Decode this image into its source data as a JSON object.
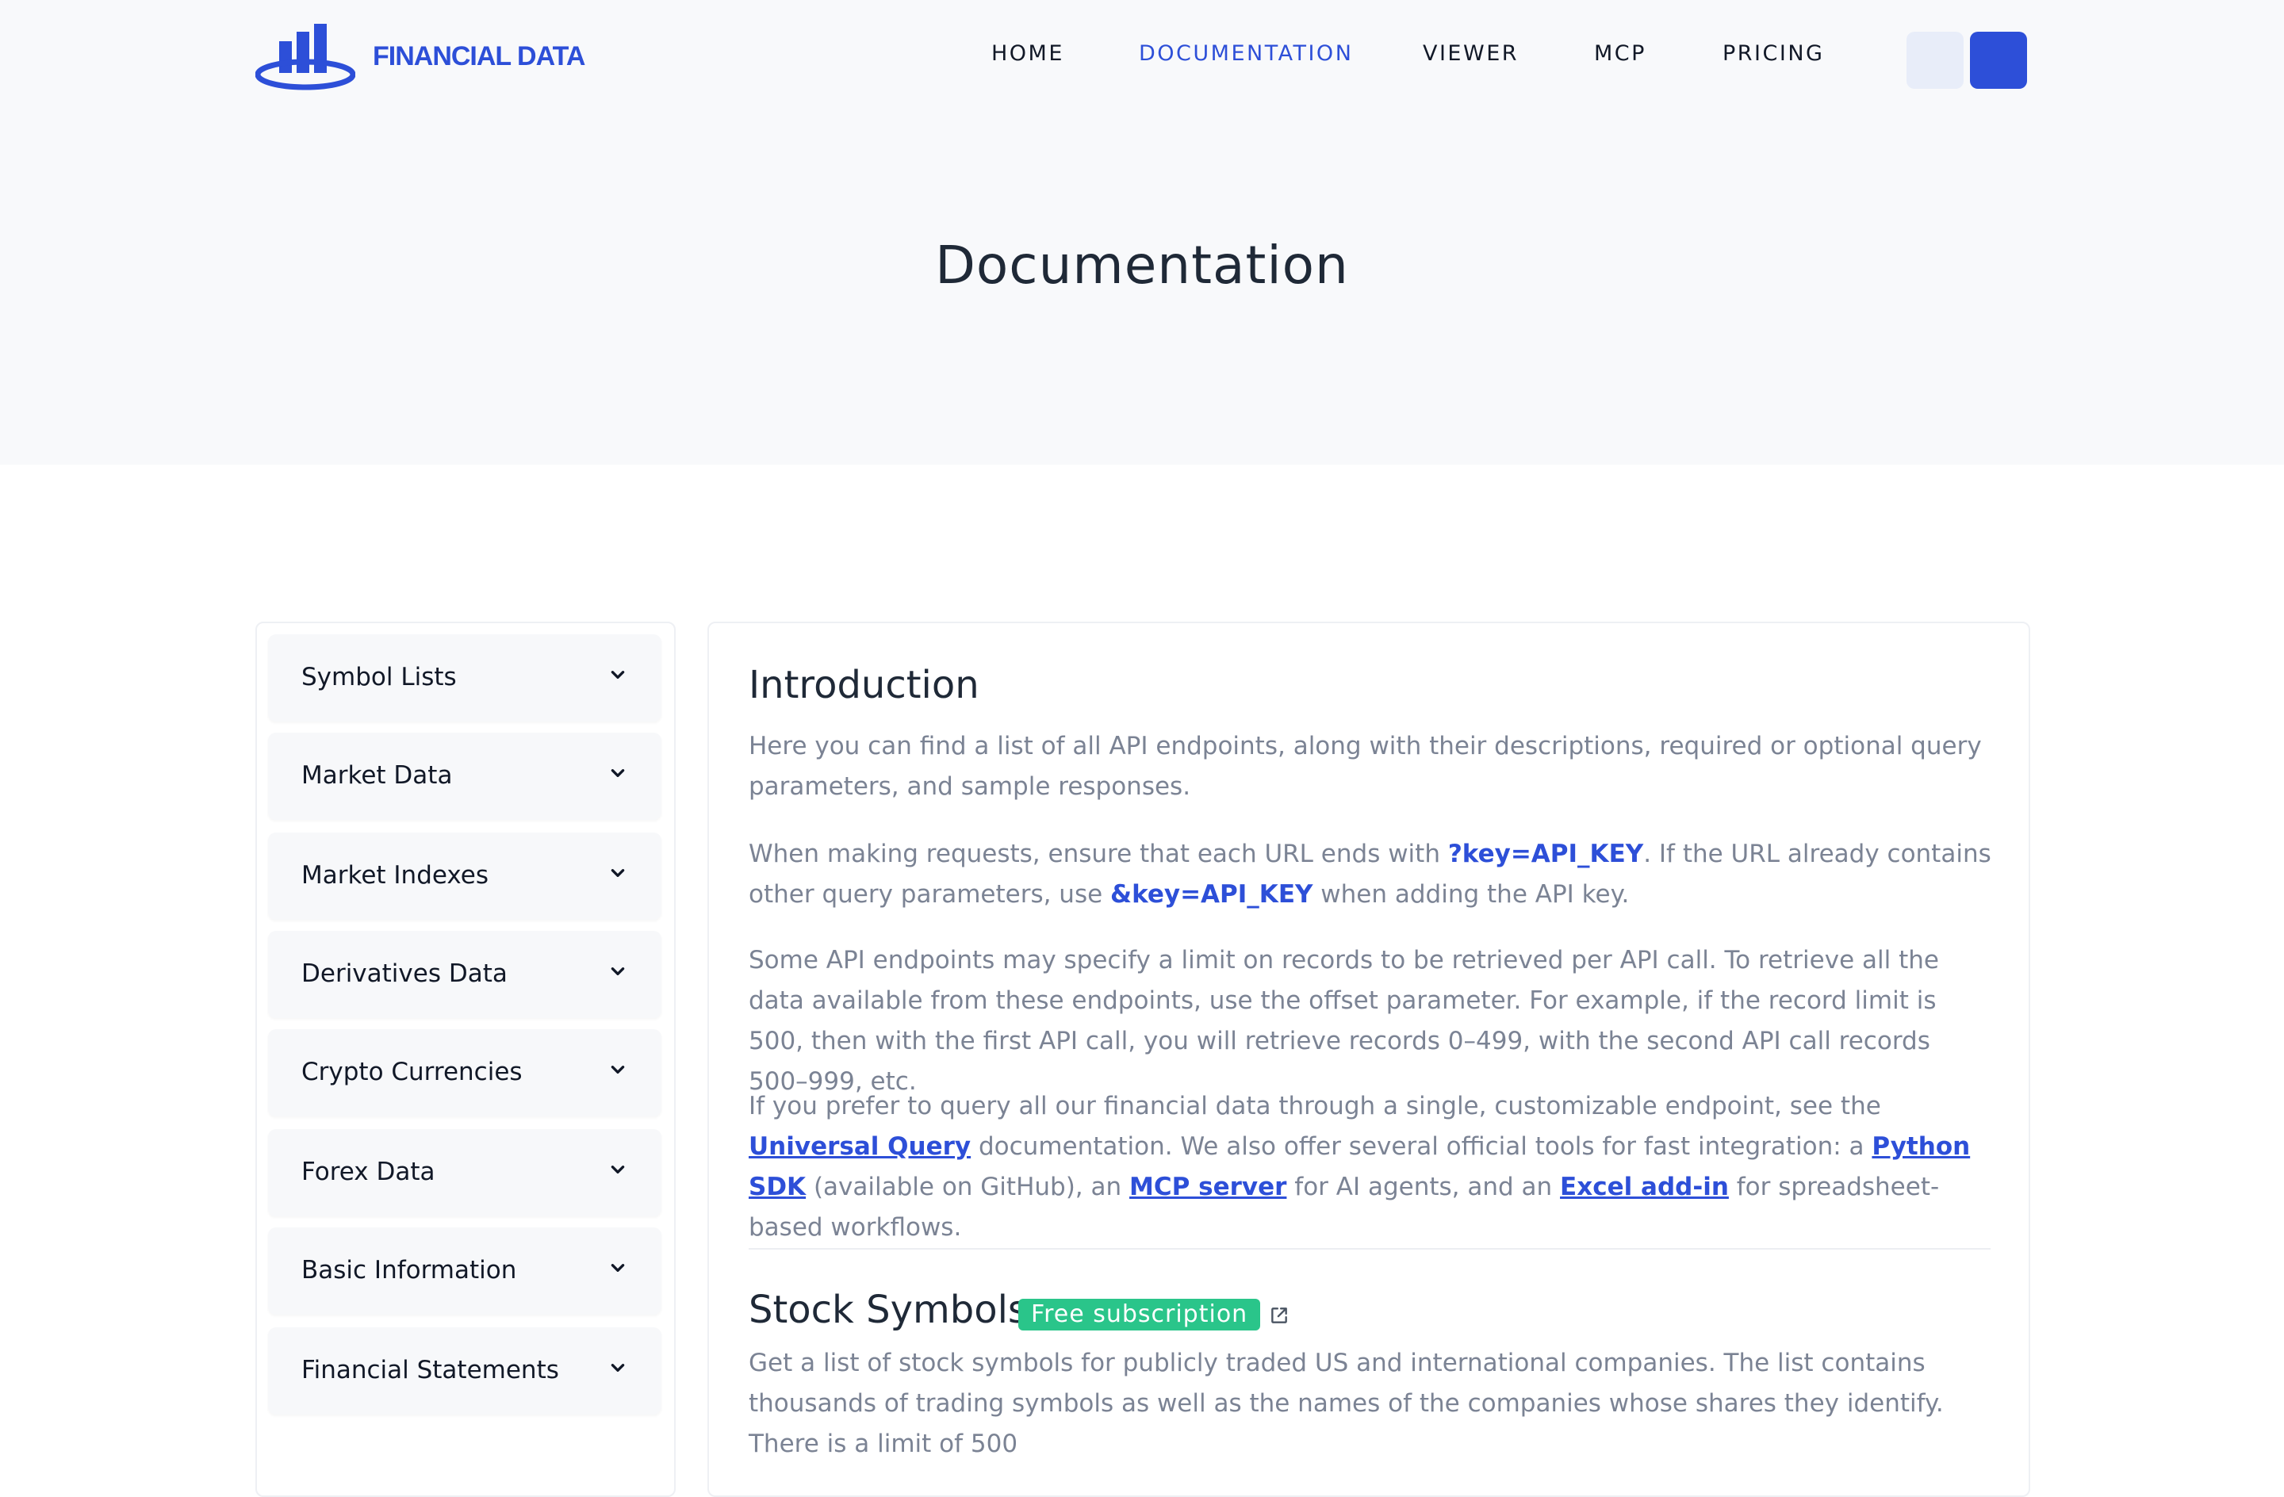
{
  "brand": {
    "name": "FINANCIAL DATA",
    "color": "#2d4fd8"
  },
  "nav": {
    "items": [
      {
        "label": "HOME"
      },
      {
        "label": "DOCUMENTATION",
        "active": true
      },
      {
        "label": "VIEWER"
      },
      {
        "label": "MCP"
      },
      {
        "label": "PRICING"
      }
    ]
  },
  "page": {
    "title": "Documentation"
  },
  "sidebar": {
    "items": [
      {
        "label": "Symbol Lists"
      },
      {
        "label": "Market Data"
      },
      {
        "label": "Market Indexes"
      },
      {
        "label": "Derivatives Data"
      },
      {
        "label": "Crypto Currencies"
      },
      {
        "label": "Forex Data"
      },
      {
        "label": "Basic Information"
      },
      {
        "label": "Financial Statements"
      }
    ]
  },
  "intro": {
    "heading": "Introduction",
    "p1": "Here you can find a list of all API endpoints, along with their descriptions, required or optional query parameters, and sample responses.",
    "p2a": "When making requests, ensure that each URL ends with ",
    "p2k1": "?key=API_KEY",
    "p2b": ". If the URL already contains other query parameters, use ",
    "p2k2": "&key=API_KEY",
    "p2c": " when adding the API key.",
    "p3": "Some API endpoints may specify a limit on records to be retrieved per API call. To retrieve all the data available from these endpoints, use the offset parameter. For example, if the record limit is 500, then with the first API call, you will retrieve records 0–499, with the second API call records 500–999, etc.",
    "p4a": "If you prefer to query all our financial data through a single, customizable endpoint, see the ",
    "p4l1": "Universal Query",
    "p4b": " documentation. We also offer several official tools for fast integration: a ",
    "p4l2": "Python SDK",
    "p4c": " (available on GitHub), an ",
    "p4l3": "MCP server",
    "p4d": " for AI agents, and an ",
    "p4l4": "Excel add-in",
    "p4e": " for spreadsheet-based workflows."
  },
  "stock": {
    "heading": "Stock Symbols",
    "badge": "Free subscription",
    "badge_color": "#2ac58a",
    "p1": "Get a list of stock symbols for publicly traded US and international companies. The list contains thousands of trading symbols as well as the names of the companies whose shares they identify. There is a limit of 500"
  }
}
